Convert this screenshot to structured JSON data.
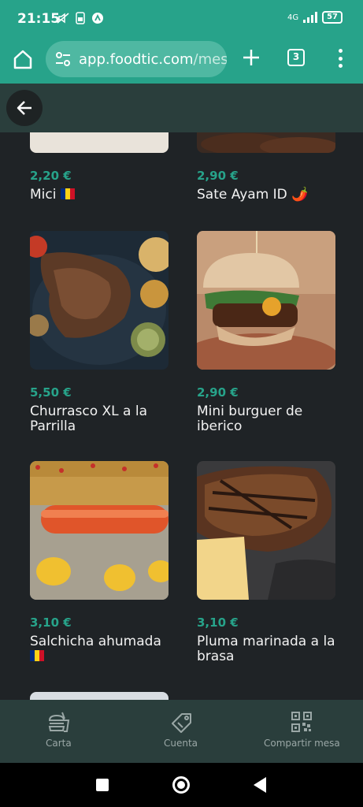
{
  "status": {
    "time": "21:15",
    "network": "4G",
    "battery": "57"
  },
  "browser": {
    "url_main": "app.foodtic.com",
    "url_dim": "/mesa",
    "tab_count": "3"
  },
  "products": [
    {
      "price": "2,20 €",
      "name": "Mici",
      "flag": "romania",
      "emoji": ""
    },
    {
      "price": "2,90 €",
      "name": "Sate Ayam ID",
      "flag": "",
      "emoji": "🌶️"
    },
    {
      "price": "5,50 €",
      "name": "Churrasco XL a la Parrilla",
      "flag": "",
      "emoji": ""
    },
    {
      "price": "2,90 €",
      "name": "Mini burguer de iberico",
      "flag": "",
      "emoji": ""
    },
    {
      "price": "3,10 €",
      "name": "Salchicha ahumada",
      "flag": "romania",
      "emoji": ""
    },
    {
      "price": "3,10 €",
      "name": "Pluma marinada a la brasa",
      "flag": "",
      "emoji": ""
    }
  ],
  "nav": {
    "menu_label": "Carta",
    "bill_label": "Cuenta",
    "share_label": "Compartir mesa"
  },
  "colors": {
    "accent": "#27a38a",
    "header": "#2a3e3c",
    "background": "#1f2326"
  }
}
